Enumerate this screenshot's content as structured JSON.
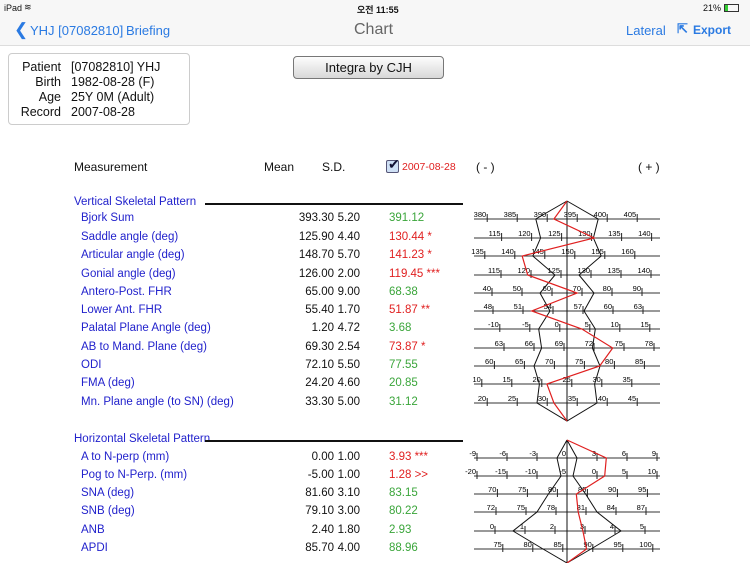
{
  "status": {
    "device": "iPad",
    "time": "오전 11:55",
    "battery": "21%"
  },
  "nav": {
    "back_label": "YHJ [07082810]",
    "briefing": "Briefing",
    "title": "Chart",
    "lateral": "Lateral",
    "export": "Export"
  },
  "patient": {
    "labels": [
      "Patient",
      "Birth",
      "Age",
      "Record"
    ],
    "values": [
      "[07082810] YHJ",
      "1982-08-28 (F)",
      "25Y 0M (Adult)",
      "2007-08-28"
    ]
  },
  "analysis_button": "Integra by CJH",
  "table": {
    "headers": {
      "measurement": "Measurement",
      "mean": "Mean",
      "sd": "S.D.",
      "date": "2007-08-28",
      "minus": "( - )",
      "plus": "( + )"
    },
    "date_checked": true
  },
  "sections": [
    {
      "title": "Vertical Skeletal Pattern",
      "rows": [
        {
          "name": "Bjork Sum",
          "mean": "393.30",
          "sd": "5.20",
          "value": "391.12",
          "flag": "",
          "abnormal": false,
          "v": 391.12,
          "m": 393.3,
          "s": 5.2,
          "step": 5,
          "ticks": [
            380,
            385,
            390,
            395,
            400,
            405
          ]
        },
        {
          "name": "Saddle angle (deg)",
          "mean": "125.90",
          "sd": "4.40",
          "value": "130.44 *",
          "abnormal": true,
          "v": 130.44,
          "m": 125.9,
          "s": 4.4,
          "step": 5,
          "ticks": [
            115,
            120,
            125,
            130,
            135,
            140
          ]
        },
        {
          "name": "Articular angle (deg)",
          "mean": "148.70",
          "sd": "5.70",
          "value": "141.23 *",
          "abnormal": true,
          "v": 141.23,
          "m": 148.7,
          "s": 5.7,
          "step": 5,
          "ticks": [
            135,
            140,
            145,
            150,
            155,
            160
          ]
        },
        {
          "name": "Gonial angle (deg)",
          "mean": "126.00",
          "sd": "2.00",
          "value": "119.45 ***",
          "abnormal": true,
          "v": 119.45,
          "m": 126,
          "s": 2,
          "step": 5,
          "ticks": [
            115,
            120,
            125,
            130,
            135,
            140
          ]
        },
        {
          "name": "Antero-Post. FHR",
          "mean": "65.00",
          "sd": "9.00",
          "value": "68.38",
          "abnormal": false,
          "v": 68.38,
          "m": 65,
          "s": 9,
          "step": 10,
          "ticks": [
            40,
            50,
            60,
            70,
            80,
            90
          ]
        },
        {
          "name": "Lower Ant. FHR",
          "mean": "55.40",
          "sd": "1.70",
          "value": "51.87 **",
          "abnormal": true,
          "v": 51.87,
          "m": 55.4,
          "s": 1.7,
          "step": 3,
          "ticks": [
            48,
            51,
            54,
            57,
            60,
            63
          ]
        },
        {
          "name": "Palatal Plane Angle (deg)",
          "mean": "1.20",
          "sd": "4.72",
          "value": "3.68",
          "abnormal": false,
          "v": 3.68,
          "m": 1.2,
          "s": 4.72,
          "step": 5,
          "ticks": [
            -10,
            -5,
            0,
            5,
            10,
            15
          ]
        },
        {
          "name": "AB to Mand. Plane (deg)",
          "mean": "69.30",
          "sd": "2.54",
          "value": "73.87 *",
          "abnormal": true,
          "v": 73.87,
          "m": 69.3,
          "s": 2.54,
          "step": 3,
          "ticks": [
            63,
            66,
            69,
            72,
            75,
            78
          ]
        },
        {
          "name": "ODI",
          "mean": "72.10",
          "sd": "5.50",
          "value": "77.55",
          "abnormal": false,
          "v": 77.55,
          "m": 72.1,
          "s": 5.5,
          "step": 5,
          "ticks": [
            60,
            65,
            70,
            75,
            80,
            85
          ]
        },
        {
          "name": "FMA (deg)",
          "mean": "24.20",
          "sd": "4.60",
          "value": "20.85",
          "abnormal": false,
          "v": 20.85,
          "m": 24.2,
          "s": 4.6,
          "step": 5,
          "ticks": [
            10,
            15,
            20,
            25,
            30,
            35
          ]
        },
        {
          "name": "Mn. Plane angle (to SN) (deg)",
          "mean": "33.30",
          "sd": "5.00",
          "value": "31.12",
          "abnormal": false,
          "v": 31.12,
          "m": 33.3,
          "s": 5,
          "step": 5,
          "ticks": [
            20,
            25,
            30,
            35,
            40,
            45
          ]
        }
      ]
    },
    {
      "title": "Horizontal Skeletal Pattern",
      "rows": [
        {
          "name": "A to N-perp (mm)",
          "mean": "0.00",
          "sd": "1.00",
          "value": "3.93 ***",
          "abnormal": true,
          "v": 3.93,
          "m": 0,
          "s": 1,
          "step": 3,
          "ticks": [
            -9,
            -6,
            -3,
            0,
            3,
            6,
            9
          ]
        },
        {
          "name": "Pog  to N-Perp. (mm)",
          "mean": "-5.00",
          "sd": "1.00",
          "value": "1.28 >>",
          "abnormal": true,
          "v": 1.28,
          "m": -5,
          "s": 1,
          "step": 5,
          "ticks": [
            -20,
            -15,
            -10,
            -5,
            0,
            5,
            10
          ]
        },
        {
          "name": "SNA (deg)",
          "mean": "81.60",
          "sd": "3.10",
          "value": "83.15",
          "abnormal": false,
          "v": 83.15,
          "m": 81.6,
          "s": 3.1,
          "step": 5,
          "ticks": [
            70,
            75,
            80,
            85,
            90,
            95
          ]
        },
        {
          "name": "SNB (deg)",
          "mean": "79.10",
          "sd": "3.00",
          "value": "80.22",
          "abnormal": false,
          "v": 80.22,
          "m": 79.1,
          "s": 3,
          "step": 3,
          "ticks": [
            72,
            75,
            78,
            81,
            84,
            87
          ]
        },
        {
          "name": "ANB",
          "mean": "2.40",
          "sd": "1.80",
          "value": "2.93",
          "abnormal": false,
          "v": 2.93,
          "m": 2.4,
          "s": 1.8,
          "step": 1,
          "ticks": [
            0,
            1,
            2,
            3,
            4,
            5
          ]
        },
        {
          "name": "APDI",
          "mean": "85.70",
          "sd": "4.00",
          "value": "88.96",
          "abnormal": false,
          "v": 88.96,
          "m": 85.7,
          "s": 4,
          "step": 5,
          "ticks": [
            75,
            80,
            85,
            90,
            95,
            100
          ]
        }
      ]
    }
  ],
  "colors": {
    "accent": "#2a7ae2",
    "label": "#2222cc",
    "normal": "#3aa53a",
    "abnormal": "#e02020"
  }
}
